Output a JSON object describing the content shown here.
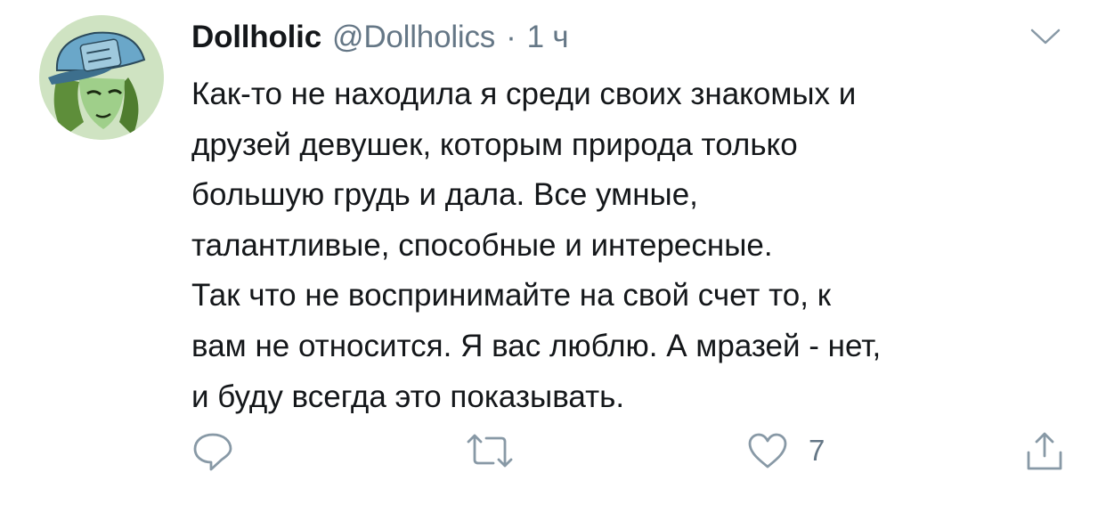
{
  "tweet": {
    "display_name": "Dollholic",
    "handle": "@Dollholics",
    "separator": "·",
    "time": "1 ч",
    "text_lines": [
      "Как-то не находила я среди своих знакомых и",
      "друзей девушек, которым природа только",
      "большую грудь и дала. Все умные,",
      "талантливые, способные и интересные.",
      "Так что не воспринимайте на свой счет то, к",
      "вам не относится. Я вас люблю. А мразей - нет,",
      "и буду всегда это показывать."
    ],
    "like_count": "7"
  },
  "colors": {
    "text_primary": "#14171a",
    "text_secondary": "#657786",
    "background": "#ffffff"
  },
  "icons": {
    "menu": "chevron-down-icon",
    "reply": "reply-icon",
    "retweet": "retweet-icon",
    "like": "heart-icon",
    "share": "share-icon"
  }
}
